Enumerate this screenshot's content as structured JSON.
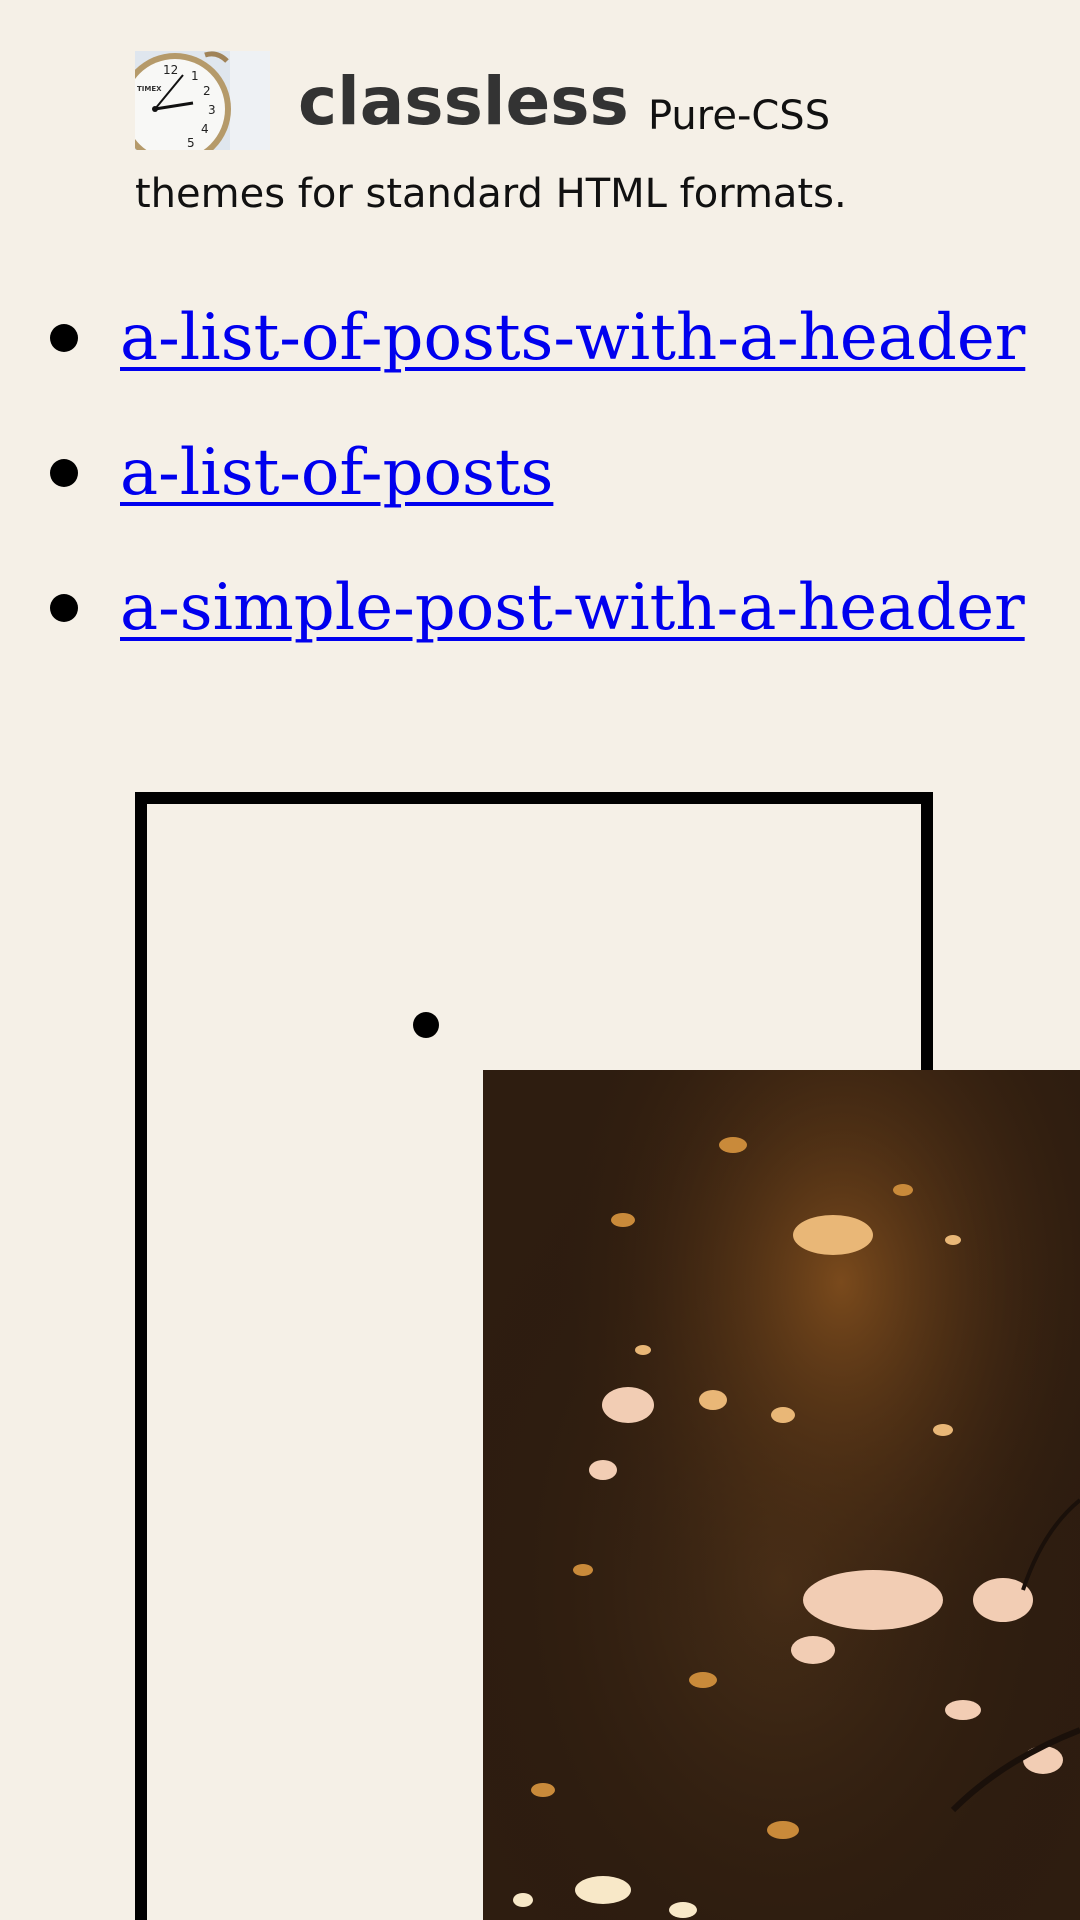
{
  "site": {
    "title": "classless",
    "tagline_line1": "Pure-CSS",
    "tagline_line2": "themes for standard HTML formats.",
    "logo_icon": "alarm-clock-icon"
  },
  "posts": [
    {
      "label": "a-list-of-posts-with-a-header"
    },
    {
      "label": "a-list-of-posts"
    },
    {
      "label": "a-simple-post-with-a-header"
    }
  ],
  "colors": {
    "background": "#f5f0e7",
    "link": "#0000ee",
    "title": "#333333"
  }
}
